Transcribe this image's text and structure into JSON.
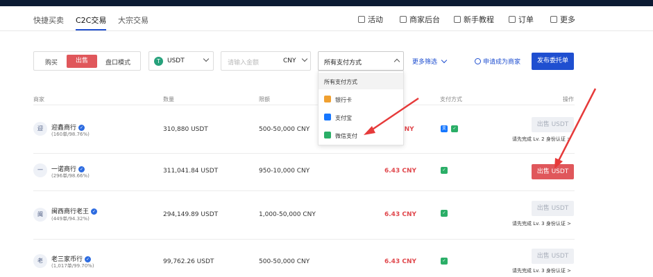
{
  "subnav": {
    "tabs": [
      {
        "label": "快捷买卖"
      },
      {
        "label": "C2C交易"
      },
      {
        "label": "大宗交易"
      }
    ],
    "links": [
      {
        "label": "活动"
      },
      {
        "label": "商家后台"
      },
      {
        "label": "新手教程"
      },
      {
        "label": "订单"
      },
      {
        "label": "更多"
      }
    ]
  },
  "filters": {
    "mode": [
      "购买",
      "出售",
      "盘口模式"
    ],
    "coin": "USDT",
    "amount_placeholder": "请输入金额",
    "currency": "CNY",
    "payment_selected": "所有支付方式",
    "more": "更多筛选",
    "apply_merchant": "申请成为商家",
    "publish": "发布委托单"
  },
  "table": {
    "headers": {
      "merchant": "商家",
      "quantity": "数量",
      "limit": "限额",
      "payment": "支付方式",
      "action": "操作"
    },
    "rows": [
      {
        "avatar": "迎",
        "name": "迎鑫商行",
        "stats": "(160单/98.76%)",
        "quantity": "310,880 USDT",
        "limit": "500-50,000 CNY",
        "price": "CNY",
        "button": "出售 USDT",
        "hint": "请先完成 Lv. 2 身份认证 >"
      },
      {
        "avatar": "一",
        "name": "一诺商行",
        "stats": "(296单/98.66%)",
        "quantity": "311,041.84 USDT",
        "limit": "950-10,000 CNY",
        "price": "6.43 CNY",
        "button": "出售 USDT",
        "hint": ""
      },
      {
        "avatar": "闽",
        "name": "闽西商行老王",
        "stats": "(449单/94.32%)",
        "quantity": "294,149.89 USDT",
        "limit": "1,000-50,000 CNY",
        "price": "6.43 CNY",
        "button": "出售 USDT",
        "hint": "请先完成 Lv. 3 身份认证 >"
      },
      {
        "avatar": "老",
        "name": "老三家币行",
        "stats": "(1,017单/99.70%)",
        "quantity": "99,762.26 USDT",
        "limit": "500-50,000 CNY",
        "price": "6.43 CNY",
        "button": "出售 USDT",
        "hint": "请先完成 Lv. 3 身份认证 >"
      }
    ]
  },
  "dropdown": {
    "options": [
      "所有支付方式",
      "银行卡",
      "支付宝",
      "微信支付"
    ]
  },
  "colors": {
    "accent": "#1f4fd0",
    "sell": "#e0575b",
    "price": "#e0474c",
    "wechat": "#2aae67",
    "alipay": "#1677ff"
  }
}
